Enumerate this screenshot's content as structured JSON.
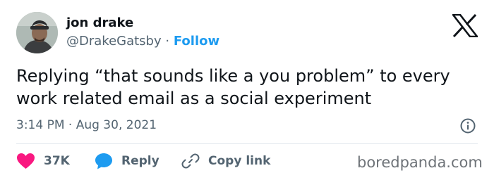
{
  "tweet": {
    "author_name": "jon drake",
    "handle": "@DrakeGatsby",
    "separator": "·",
    "follow_label": "Follow",
    "text": "Replying “that sounds like a you problem” to every work related email as a social experiment",
    "timestamp": "3:14 PM · Aug 30, 2021"
  },
  "actions": {
    "like_count": "37K",
    "reply_label": "Reply",
    "copy_link_label": "Copy link"
  },
  "watermark": "boredpanda.com",
  "icons": {
    "platform_logo": "x-logo-icon",
    "info": "info-icon",
    "like": "heart-icon",
    "reply": "speech-bubble-icon",
    "copy": "link-icon"
  },
  "colors": {
    "text": "#0f1419",
    "secondary": "#536471",
    "follow": "#1d9bf0",
    "heart": "#f91880",
    "reply": "#1d9bf0",
    "watermark": "#6e7378"
  }
}
